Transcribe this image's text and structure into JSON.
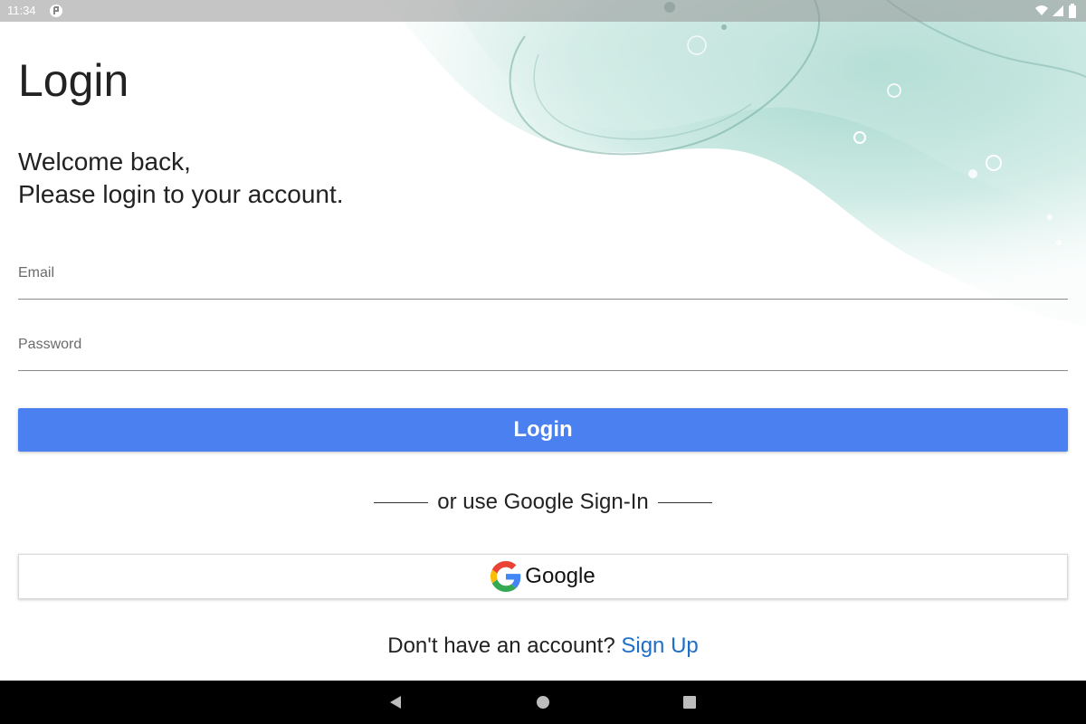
{
  "status_bar": {
    "time": "11:34",
    "app_icon": "app-notification-icon",
    "wifi_icon": "wifi-icon",
    "signal_icon": "cell-signal-icon",
    "battery_icon": "battery-icon"
  },
  "screen": {
    "title": "Login",
    "welcome_line1": "Welcome back,",
    "welcome_line2": "Please login to your account."
  },
  "form": {
    "email_label": "Email",
    "email_value": "",
    "password_label": "Password",
    "password_value": "",
    "login_button": "Login"
  },
  "divider": {
    "text": "or use Google Sign-In"
  },
  "google": {
    "label": "Google",
    "icon": "google-logo-icon"
  },
  "signup": {
    "prompt": "Don't have an account?",
    "link": "Sign Up"
  },
  "navigation": {
    "back_icon": "back-triangle-icon",
    "home_icon": "home-circle-icon",
    "recents_icon": "recents-square-icon"
  },
  "colors": {
    "primary_button": "#4a80ef",
    "link": "#1e6fc8",
    "watercolor": "#8fd1c4"
  }
}
